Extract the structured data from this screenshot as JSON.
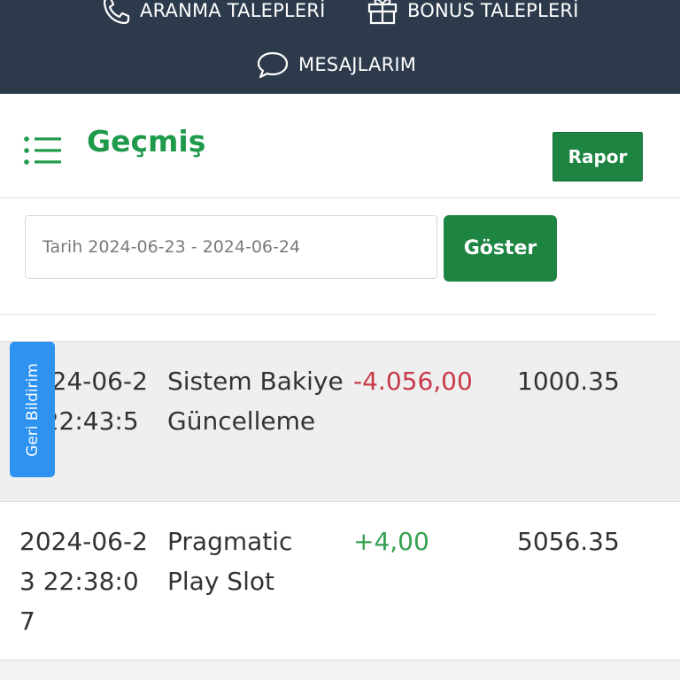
{
  "nav": {
    "calls_label": "ARANMA TALEPLERİ",
    "bonus_label": "BONUS TALEPLERİ",
    "messages_label": "MESAJLARIM"
  },
  "header": {
    "title": "Geçmiş",
    "report_button": "Rapor"
  },
  "filter": {
    "date_value": "Tarih 2024-06-23 - 2024-06-24",
    "show_button": "Göster"
  },
  "transactions": [
    {
      "date": "2024-06-23 22:43:51",
      "description": "Sistem Bakiye Güncelleme",
      "amount": "-4.056,00",
      "amount_type": "negative",
      "balance": "1000.35"
    },
    {
      "date": "2024-06-23 22:38:07",
      "description": "Pragmatic Play Slot",
      "amount": "+4,00",
      "amount_type": "positive",
      "balance": "5056.35"
    }
  ],
  "feedback_tab": {
    "label": "Geri Bildirim"
  },
  "colors": {
    "nav_bg": "#2c3a4b",
    "accent_green": "#1d8442",
    "title_green": "#1f9a4b",
    "negative": "#c8394a",
    "positive": "#36a150",
    "feedback_blue": "#2d92f0"
  },
  "icons": {
    "calls": "phone-icon",
    "bonus": "gift-icon",
    "messages": "chat-bubble-icon",
    "menu": "list-menu-icon"
  }
}
